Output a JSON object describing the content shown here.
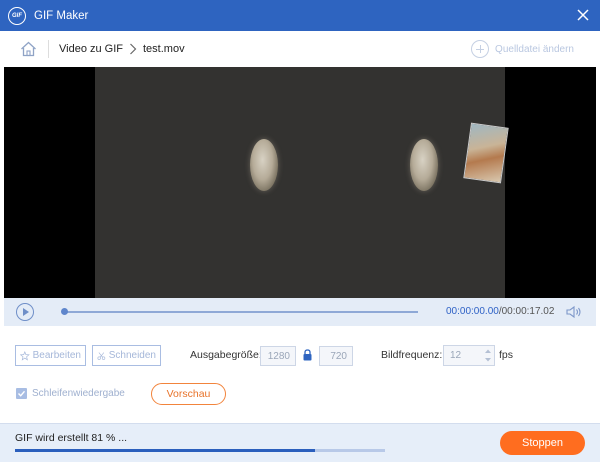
{
  "window": {
    "title": "GIF Maker",
    "logo_text": "GIF",
    "accent_color": "#2e64c0"
  },
  "breadcrumb": {
    "home_icon": "home-icon",
    "section": "Video zu GIF",
    "file": "test.mov"
  },
  "source": {
    "label": "Quelldatei ändern"
  },
  "player": {
    "current_time": "00:00:00.00",
    "duration": "/00:00:17.02",
    "progress_fraction": 0.0
  },
  "tools": {
    "edit_label": "Bearbeiten",
    "cut_label": "Schneiden"
  },
  "output": {
    "size_label": "Ausgabegröße:",
    "width": "1280",
    "height": "720",
    "framerate_label": "Bildfrequenz:",
    "framerate": "12",
    "framerate_unit": "fps"
  },
  "loop": {
    "label": "Schleifenwiedergabe",
    "checked": true
  },
  "preview": {
    "label": "Vorschau"
  },
  "status": {
    "text": "GIF wird erstellt 81 % ...",
    "progress_percent": 81
  },
  "stop": {
    "label": "Stoppen",
    "color": "#ff6d1f"
  }
}
